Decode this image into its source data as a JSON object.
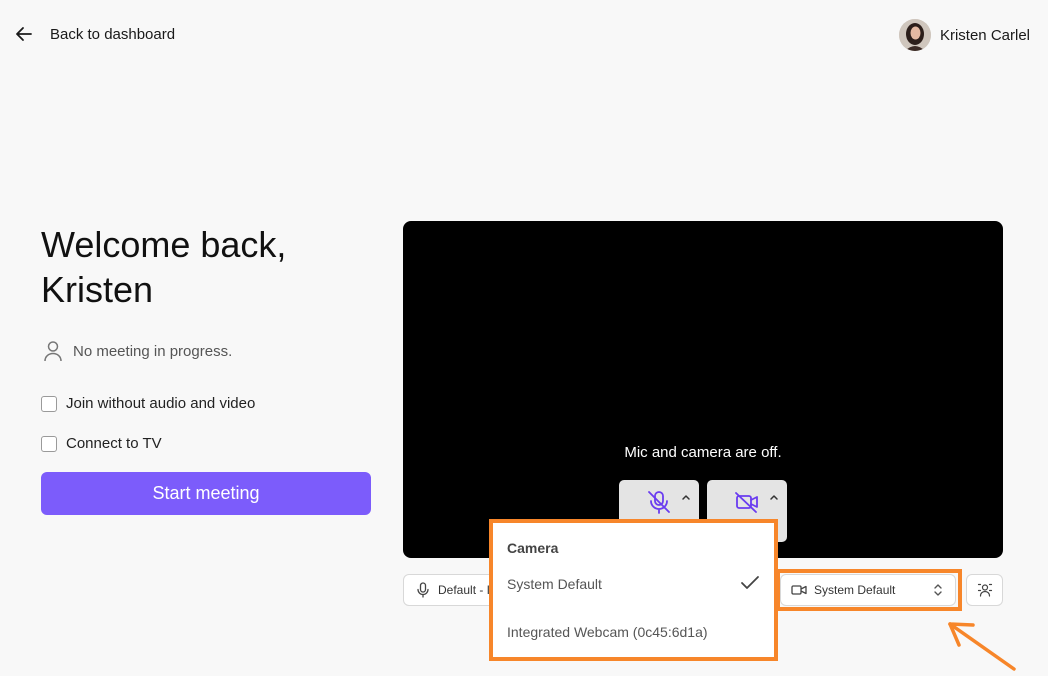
{
  "header": {
    "back_label": "Back to dashboard",
    "user_name": "Kristen Carlel"
  },
  "main": {
    "title_line1": "Welcome back,",
    "title_line2": "Kristen",
    "status": "No meeting in progress.",
    "options": [
      {
        "label": "Join without audio and video",
        "checked": false
      },
      {
        "label": "Connect to TV",
        "checked": false
      }
    ],
    "start_button": "Start meeting"
  },
  "preview": {
    "status_text": "Mic and camera are off."
  },
  "devices": {
    "mic_label": "Default - I",
    "camera_label": "System Default"
  },
  "camera_menu": {
    "title": "Camera",
    "options": [
      {
        "label": "System Default",
        "selected": true
      },
      {
        "label": "Integrated Webcam (0c45:6d1a)",
        "selected": false
      }
    ]
  },
  "colors": {
    "accent": "#7c5cfb",
    "highlight": "#f7862a",
    "mic_off_icon": "#6a3cf0"
  },
  "icons": [
    "arrow-left-icon",
    "person-icon",
    "mic-off-icon",
    "camera-off-icon",
    "chevron-up-icon",
    "mic-icon",
    "video-icon",
    "updown-icon",
    "check-icon",
    "background-effects-icon",
    "arrow-icon"
  ]
}
